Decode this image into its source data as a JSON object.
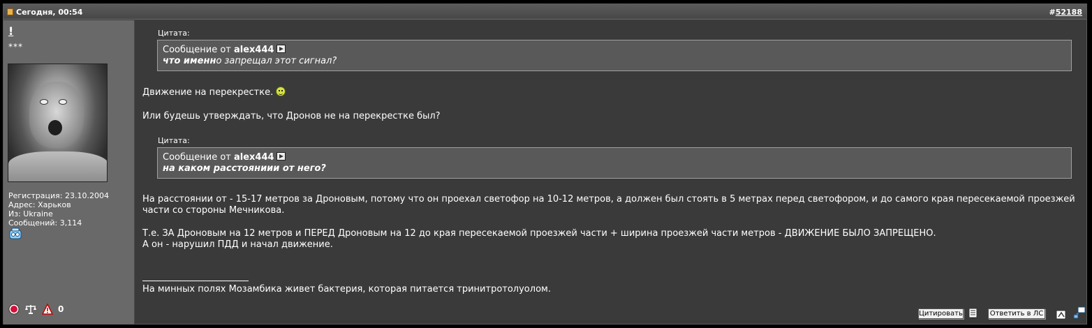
{
  "header": {
    "date": "Сегодня, 00:54",
    "post_number_prefix": "#",
    "post_number": "52188"
  },
  "user": {
    "username": "!",
    "title": "***",
    "registration": "Регистрация: 23.10.2004",
    "address": "Адрес: Харьков",
    "from": "Из: Ukraine",
    "posts": "Сообщений: 3,114",
    "reputation": "0"
  },
  "quotes": [
    {
      "label": "Цитата:",
      "from_prefix": "Сообщение от",
      "author": "alex444",
      "text_bold": "что именн",
      "text_rest": "о запрещал этот сигнал?"
    },
    {
      "label": "Цитата:",
      "from_prefix": "Сообщение от",
      "author": "alex444",
      "text_bold": "на каком расстояниии от него?",
      "text_rest": ""
    }
  ],
  "body": {
    "p1": "Движение на перекрестке.",
    "p2": "Или будешь утверждать, что Дронов не на перекрестке был?",
    "p3_line1": "На расстоянии от - 15-17 метров за Дроновым, потому что он проехал светофор на 10-12 метров, а должен был стоять в 5 метрах перед светофором, и до самого края пересекаемой проезжей",
    "p3_line2": "части со стороны Мечникова.",
    "p4_line1": "Т.е. ЗА Дроновым на 12 метров и ПЕРЕД Дроновым на 12 до края пересекаемой проезжей части + ширина проезжей части метров - ДВИЖЕНИЕ БЫЛО ЗАПРЕЩЕНО.",
    "p4_line2": "А он - нарушил ПДД и начал движение."
  },
  "signature": "На минных полях Мозамбика живет бактерия, которая питается тринитротолуолом.",
  "buttons": {
    "quote": "Цитировать",
    "reply_pm": "Ответить в ЛС"
  },
  "colors": {
    "post_bg": "#3a3a3a",
    "user_column_bg": "#696969",
    "quote_bg": "#595959",
    "header_bg": "#4f4f4f"
  },
  "icons": [
    "post-status-icon",
    "online-status-icon",
    "report-icon",
    "reputation-scales-icon",
    "warning-icon",
    "multiquote-icon",
    "quick-reply-icon",
    "new-reply-icon",
    "view-post-icon",
    "smile-icon"
  ]
}
